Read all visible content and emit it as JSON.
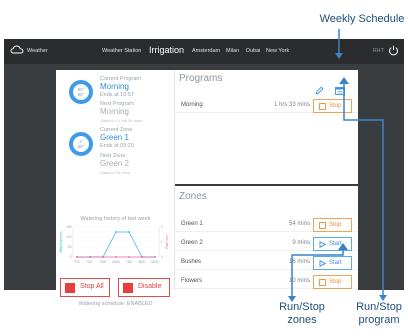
{
  "callouts": {
    "weekly_schedule": "Weekly Schedule",
    "run_stop_zones_1": "Run/Stop",
    "run_stop_zones_2": "zones",
    "run_stop_program_1": "Run/Stop",
    "run_stop_program_2": "program"
  },
  "topbar": {
    "app_label": "Weather",
    "nav_items": [
      "Weather Station",
      "Irrigation",
      "Amsterdam",
      "Milan",
      "Dubai",
      "New York"
    ],
    "active_item": "Irrigation",
    "right_text": "RHT"
  },
  "status": {
    "current_program_label": "Current Program",
    "current_program": "Morning",
    "current_program_ends": "Ends at 10:57",
    "next_program_label": "Next Program",
    "next_program": "Morning",
    "next_program_starts": "Starts in 21 hrs 38 mins",
    "program_ring_top": "90°",
    "program_ring_bottom": "58°",
    "current_zone_label": "Current Zone",
    "current_zone": "Green 1",
    "current_zone_ends": "Ends at 09:29",
    "next_zone_label": "Next Zone",
    "next_zone": "Green 2",
    "next_zone_starts": "Starts in 19 mins",
    "zone_ring_top": "4'",
    "zone_ring_bottom": "58°"
  },
  "history": {
    "title": "Watering history of last week",
    "left_axis_label": "Watering mins",
    "right_axis_label": "Rain mm",
    "ylim": [
      0,
      150
    ],
    "y_ticks": [
      "150",
      "100",
      "50",
      "0"
    ],
    "right_ticks": [
      "2",
      "1",
      "0"
    ]
  },
  "chart_data": {
    "type": "line",
    "title": "Watering history of last week",
    "categories": [
      "FRI",
      "SAT",
      "SUN",
      "MON",
      "TUE",
      "WED",
      "MON"
    ],
    "series": [
      {
        "name": "Watering mins",
        "values": [
          0,
          0,
          0,
          125,
          125,
          0,
          0
        ],
        "color": "#28b4e8"
      },
      {
        "name": "Rain mm",
        "values": [
          0,
          0,
          0,
          0,
          0,
          0,
          0
        ],
        "color": "#f15aa0"
      }
    ],
    "ylim": [
      0,
      150
    ],
    "xlabel": "",
    "ylabel": "Watering mins"
  },
  "buttons": {
    "stop_all": "Stop All",
    "disable": "Disable",
    "watering_schedule": "Watering schedule: ENABLED"
  },
  "programs": {
    "title": "Programs",
    "rows": [
      {
        "name": "Morning",
        "duration": "1 hrs 33 mins",
        "action": "Stop",
        "state": "running"
      }
    ]
  },
  "zones": {
    "title": "Zones",
    "rows": [
      {
        "name": "Green 1",
        "duration": "54 mins",
        "action": "Stop",
        "state": "running"
      },
      {
        "name": "Green 2",
        "duration": "9 mins",
        "action": "Start",
        "state": "idle"
      },
      {
        "name": "Bushes",
        "duration": "16 mins",
        "action": "Start",
        "state": "idle"
      },
      {
        "name": "Flowers",
        "duration": "10 mins",
        "action": "Stop",
        "state": "running"
      }
    ]
  },
  "colors": {
    "accent_blue": "#2f8fe6",
    "stop_orange": "#f08a3a",
    "danger_red": "#e83d3d",
    "callout_blue": "#1f4e79",
    "callout_line": "#3b83c4"
  }
}
